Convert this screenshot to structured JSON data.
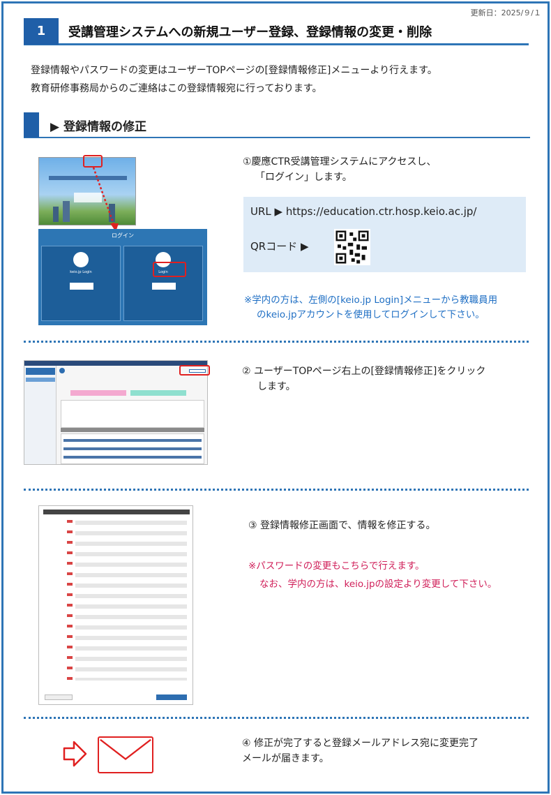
{
  "update_date": "更新日：2025/９/１",
  "header": {
    "number": "1",
    "title": "受講管理システムへの新規ユーザー登録、登録情報の変更・削除"
  },
  "intro": {
    "line1": "登録情報やパスワードの変更はユーザーTOPページの[登録情報修正]メニューより行えます。",
    "line2": "教育研修事務局からのご連絡はこの登録情報宛に行っております。"
  },
  "section": {
    "title": "▶ 登録情報の修正"
  },
  "step1": {
    "line1": "①慶應CTR受講管理システムにアクセスし、",
    "line2": "「ログイン」します。",
    "url_label": "URL ▶ https://education.ctr.hosp.keio.ac.jp/",
    "qr_label": "QRコード ▶",
    "note_line1": "※学内の方は、左側の[keio.jp Login]メニューから教職員用",
    "note_line2": "のkeio.jpアカウントを使用してログインして下さい。",
    "screenshot": {
      "login_title": "ログイン",
      "card1_label": "keio.jp Login",
      "card2_label": "Login"
    }
  },
  "step2": {
    "line1": "② ユーザーTOPページ右上の[登録情報修正]をクリック",
    "line2": "します。"
  },
  "step3": {
    "line1": "③ 登録情報修正画面で、情報を修正する。",
    "note_line1": "※パスワードの変更もこちらで行えます。",
    "note_line2": "なお、学内の方は、keio.jpの設定より変更して下さい。"
  },
  "step4": {
    "line1": "④ 修正が完了すると登録メールアドレス宛に変更完了",
    "line2": "メールが届きます。"
  },
  "colors": {
    "accent": "#2e75b6",
    "header_blue": "#1f5fa8",
    "note_blue": "#1f6fc4",
    "note_red": "#d0205a",
    "highlight_red": "#e02020"
  },
  "icons": [
    "mail-icon",
    "arrow-right-icon",
    "qr-code-icon"
  ]
}
